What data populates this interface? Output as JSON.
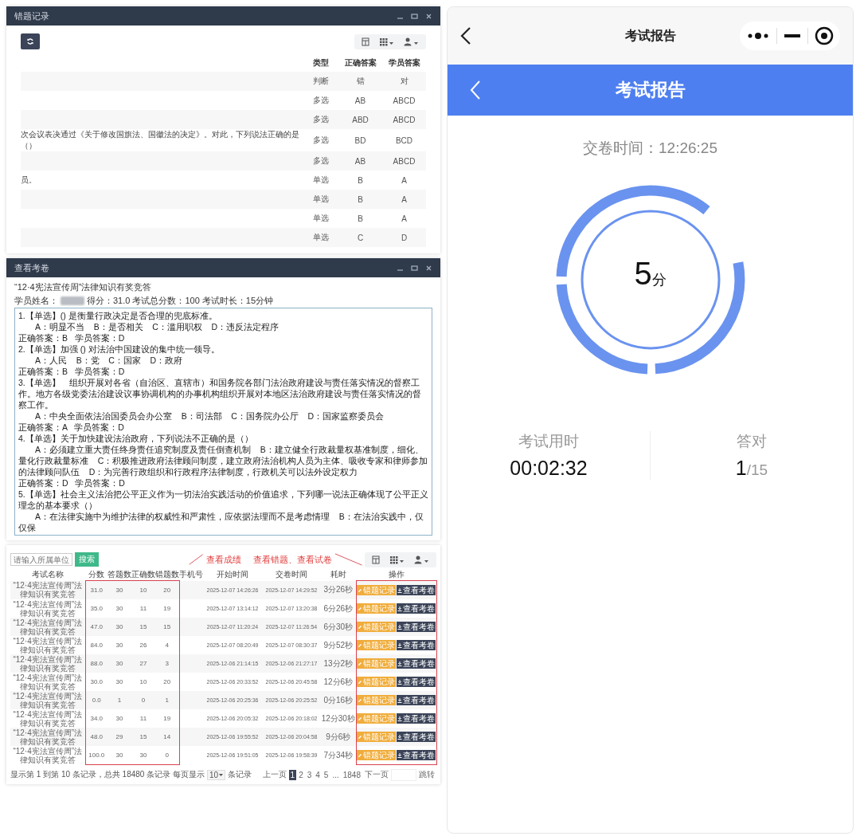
{
  "error_window": {
    "title": "错题记录",
    "columns": [
      "类型",
      "正确答案",
      "学员答案"
    ],
    "rows": [
      {
        "type": "判断",
        "correct": "错",
        "student": "对"
      },
      {
        "type": "多选",
        "correct": "AB",
        "student": "ABCD"
      },
      {
        "type": "多选",
        "correct": "ABD",
        "student": "ABCD"
      },
      {
        "question": "次会议表决通过《关于修改国旗法、国徽法的决定》。对此，下列说法正确的是（）",
        "type": "多选",
        "correct": "BD",
        "student": "BCD"
      },
      {
        "type": "多选",
        "correct": "AB",
        "student": "ABCD"
      },
      {
        "question": "员。",
        "type": "单选",
        "correct": "B",
        "student": "A"
      },
      {
        "type": "单选",
        "correct": "B",
        "student": "A"
      },
      {
        "type": "单选",
        "correct": "B",
        "student": "A"
      },
      {
        "type": "单选",
        "correct": "C",
        "student": "D"
      }
    ]
  },
  "paper_window": {
    "title": "查看考卷",
    "exam_title": "“12·4宪法宣传周”法律知识有奖竞答",
    "student_label": "学员姓名：",
    "student_info": "得分：31.0 考试总分数：100 考试时长：15分钟",
    "lines": [
      {
        "kind": "question",
        "text": "1.【单选】() 是衡量行政决定是否合理的兜底标准。"
      },
      {
        "kind": "options",
        "text": "A：明显不当    B：是否相关    C：滥用职权    D：违反法定程序"
      },
      {
        "kind": "answer",
        "text": "正确答案：B   学员答案：D"
      },
      {
        "kind": "question",
        "text": "2.【单选】加强 () 对法治中国建设的集中统一领导。"
      },
      {
        "kind": "options",
        "text": "A：人民    B：党    C：国家    D：政府"
      },
      {
        "kind": "answer",
        "text": "正确答案：B   学员答案：D"
      },
      {
        "kind": "question",
        "text": "3.【单选】    组织开展对各省（自治区、直辖市）和国务院各部门法治政府建设与责任落实情况的督察工作。地方各级党委法治建设议事协调机构的办事机构组织开展对本地区法治政府建设与责任落实情况的督察工作。"
      },
      {
        "kind": "options",
        "text": "A：中央全面依法治国委员会办公室    B：司法部    C：国务院办公厅    D：国家监察委员会"
      },
      {
        "kind": "answer",
        "text": "正确答案：A   学员答案：D"
      },
      {
        "kind": "question",
        "text": "4.【单选】关于加快建设法治政府，下列说法不正确的是（）"
      },
      {
        "kind": "options",
        "text": "A：必须建立重大责任终身责任追究制度及责任倒查机制    B：建立健全行政裁量权基准制度，细化、量化行政裁量标准    C：积极推进政府法律顾问制度，建立政府法治机构人员为主体、吸收专家和律师参加的法律顾问队伍    D：为完善行政组织和行政程序法律制度，行政机关可以法外设定权力"
      },
      {
        "kind": "answer",
        "text": "正确答案：D   学员答案：D"
      },
      {
        "kind": "question",
        "text": "5.【单选】社会主义法治把公平正义作为一切法治实践活动的价值追求，下列哪一说法正确体现了公平正义理念的基本要求（）"
      },
      {
        "kind": "options",
        "text": "A：在法律实施中为维护法律的权威性和严肃性，应依据法理而不是考虑情理    B：在法治实践中，仅仅保"
      }
    ]
  },
  "records": {
    "search": {
      "placeholder": "请输入所属单位"
    },
    "search_button": "搜索",
    "annotations": [
      "查看成绩",
      "查看错题、查看试卷"
    ],
    "columns": [
      "考试名称",
      "分数",
      "答题数",
      "正确数",
      "错题数",
      "手机号",
      "开始时间",
      "交卷时间",
      "耗时",
      "操作"
    ],
    "rows": [
      {
        "name": "“12·4宪法宣传周”法律知识有奖竞答",
        "score": "31.0",
        "answered": "30",
        "correct": "10",
        "wrong": "20",
        "start": "2025-12-07 14:26:26",
        "end": "2025-12-07 14:29:52",
        "duration": "3分26秒",
        "actions": [
          "错题记录",
          "查看考卷"
        ]
      },
      {
        "name": "“12·4宪法宣传周”法律知识有奖竞答",
        "score": "35.0",
        "answered": "30",
        "correct": "11",
        "wrong": "19",
        "start": "2025-12-07 13:14:12",
        "end": "2025-12-07 13:20:38",
        "duration": "6分26秒",
        "actions": [
          "错题记录",
          "查看考卷"
        ]
      },
      {
        "name": "“12·4宪法宣传周”法律知识有奖竞答",
        "score": "47.0",
        "answered": "30",
        "correct": "15",
        "wrong": "15",
        "start": "2025-12-07 11:20:24",
        "end": "2025-12-07 11:26:54",
        "duration": "6分30秒",
        "actions": [
          "错题记录",
          "查看考卷"
        ]
      },
      {
        "name": "“12·4宪法宣传周”法律知识有奖竞答",
        "score": "84.0",
        "answered": "30",
        "correct": "26",
        "wrong": "4",
        "start": "2025-12-07 08:20:49",
        "end": "2025-12-07 08:30:37",
        "duration": "9分52秒",
        "actions": [
          "错题记录",
          "查看考卷"
        ]
      },
      {
        "name": "“12·4宪法宣传周”法律知识有奖竞答",
        "score": "88.0",
        "answered": "30",
        "correct": "27",
        "wrong": "3",
        "start": "2025-12-06 21:14:15",
        "end": "2025-12-06 21:27:17",
        "duration": "13分2秒",
        "actions": [
          "错题记录",
          "查看考卷"
        ]
      },
      {
        "name": "“12·4宪法宣传周”法律知识有奖竞答",
        "score": "30.0",
        "answered": "30",
        "correct": "10",
        "wrong": "20",
        "start": "2025-12-06 20:33:52",
        "end": "2025-12-06 20:45:58",
        "duration": "12分6秒",
        "actions": [
          "错题记录",
          "查看考卷"
        ]
      },
      {
        "name": "“12·4宪法宣传周”法律知识有奖竞答",
        "score": "0.0",
        "answered": "1",
        "correct": "0",
        "wrong": "1",
        "start": "2025-12-06 20:25:36",
        "end": "2025-12-06 20:25:52",
        "duration": "0分16秒",
        "actions": [
          "错题记录",
          "查看考卷"
        ]
      },
      {
        "name": "“12·4宪法宣传周”法律知识有奖竞答",
        "score": "34.0",
        "answered": "30",
        "correct": "11",
        "wrong": "19",
        "start": "2025-12-06 20:05:32",
        "end": "2025-12-06 20:18:02",
        "duration": "12分30秒",
        "actions": [
          "错题记录",
          "查看考卷"
        ]
      },
      {
        "name": "“12·4宪法宣传周”法律知识有奖竞答",
        "score": "48.0",
        "answered": "29",
        "correct": "15",
        "wrong": "14",
        "start": "2025-12-06 19:55:52",
        "end": "2025-12-06 20:04:58",
        "duration": "9分6秒",
        "actions": [
          "错题记录",
          "查看考卷"
        ]
      },
      {
        "name": "“12·4宪法宣传周”法律知识有奖竞答",
        "score": "100.0",
        "answered": "30",
        "correct": "30",
        "wrong": "0",
        "start": "2025-12-06 19:51:05",
        "end": "2025-12-06 19:58:39",
        "duration": "7分34秒",
        "actions": [
          "错题记录",
          "查看考卷"
        ]
      }
    ],
    "summary": "显示第 1 到第 10 条记录，总共 18480 条记录 每页显示",
    "page_size": "10",
    "page_size_suffix": "条记录",
    "pages": [
      {
        "label": "上一页",
        "selected": false
      },
      {
        "label": "1",
        "selected": true
      },
      {
        "label": "2",
        "selected": false
      },
      {
        "label": "3",
        "selected": false
      },
      {
        "label": "4",
        "selected": false
      },
      {
        "label": "5",
        "selected": false
      },
      {
        "label": "...",
        "selected": false
      },
      {
        "label": "1848",
        "selected": false
      },
      {
        "label": "下一页",
        "selected": false
      }
    ],
    "jump_button": "跳转"
  },
  "report": {
    "nav_title": "考试报告",
    "header_title": "考试报告",
    "submit_time": "交卷时间：12:26:25",
    "score": "5",
    "score_unit": "分",
    "stats": [
      {
        "kind": "time",
        "label": "考试用时",
        "value": "00:02:32"
      },
      {
        "kind": "fraction",
        "label": "答对",
        "value": "1",
        "total": "/15"
      }
    ]
  }
}
